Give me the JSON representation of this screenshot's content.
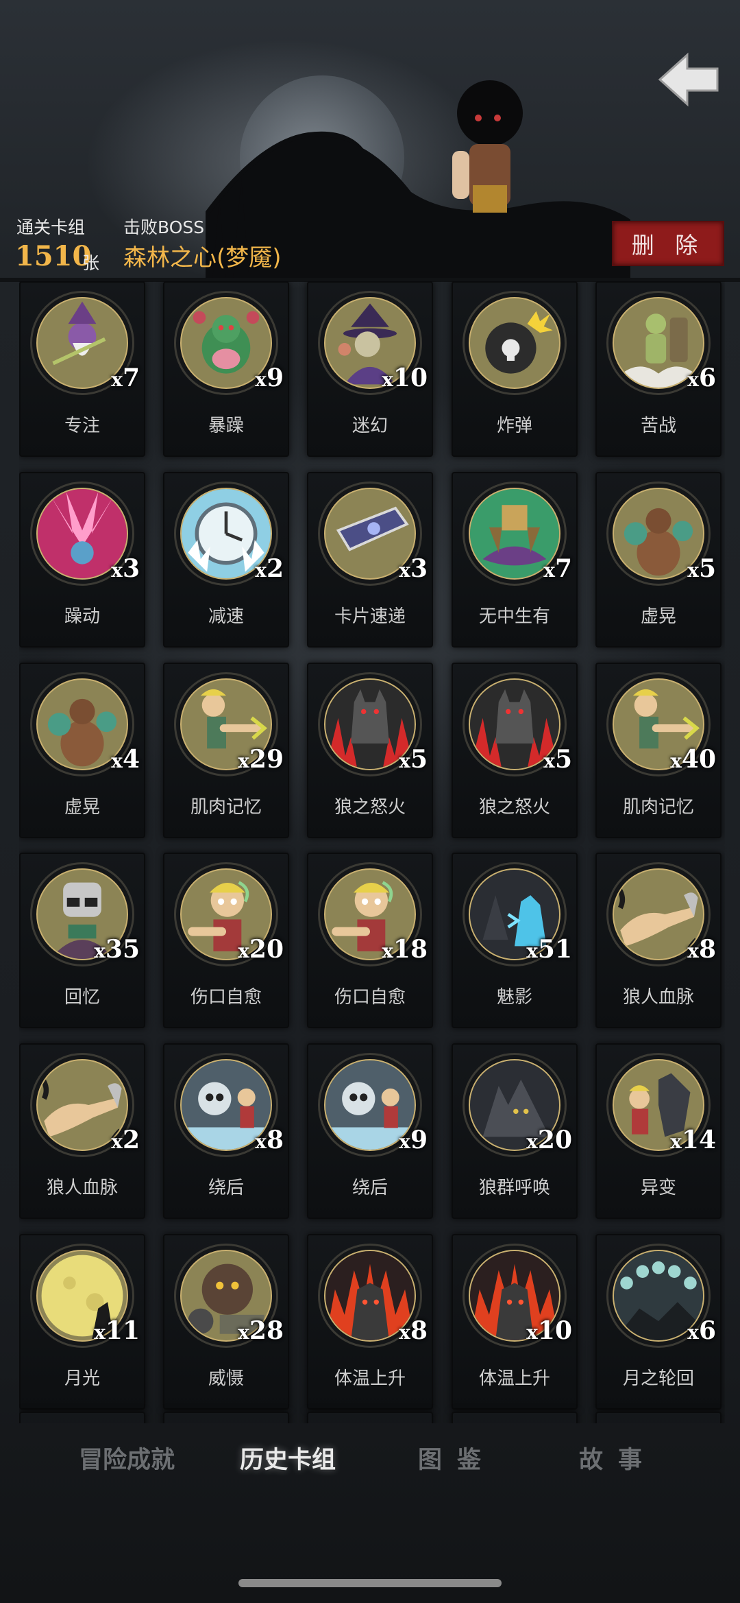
{
  "header": {
    "cards_label": "通关卡组",
    "cards_count": "1510",
    "cards_unit": "张",
    "boss_label": "击败BOSS",
    "boss_name": "森林之心(梦魇)",
    "delete_label": "删 除"
  },
  "colors": {
    "accent": "#f2b64a",
    "delete": "#8e1b1b",
    "background": "#1b1e22"
  },
  "cards": [
    {
      "name": "专注",
      "qty": "7",
      "art": "wizard"
    },
    {
      "name": "暴躁",
      "qty": "9",
      "art": "ogre"
    },
    {
      "name": "迷幻",
      "qty": "10",
      "art": "witch"
    },
    {
      "name": "炸弹",
      "qty": "",
      "art": "bomb"
    },
    {
      "name": "苦战",
      "qty": "6",
      "art": "soldier"
    },
    {
      "name": "躁动",
      "qty": "3",
      "art": "burst"
    },
    {
      "name": "减速",
      "qty": "2",
      "art": "clock"
    },
    {
      "name": "卡片速递",
      "qty": "3",
      "art": "card"
    },
    {
      "name": "无中生有",
      "qty": "7",
      "art": "spawn"
    },
    {
      "name": "虚晃",
      "qty": "5",
      "art": "boxer"
    },
    {
      "name": "虚晃",
      "qty": "4",
      "art": "boxer"
    },
    {
      "name": "肌肉记忆",
      "qty": "29",
      "art": "kid-arm"
    },
    {
      "name": "狼之怒火",
      "qty": "5",
      "art": "wolf-red"
    },
    {
      "name": "狼之怒火",
      "qty": "5",
      "art": "wolf-red"
    },
    {
      "name": "肌肉记忆",
      "qty": "40",
      "art": "kid-arm"
    },
    {
      "name": "回忆",
      "qty": "35",
      "art": "grandpa"
    },
    {
      "name": "伤口自愈",
      "qty": "20",
      "art": "kid-hurt"
    },
    {
      "name": "伤口自愈",
      "qty": "18",
      "art": "kid-hurt"
    },
    {
      "name": "魅影",
      "qty": "51",
      "art": "phantom"
    },
    {
      "name": "狼人血脉",
      "qty": "8",
      "art": "arm"
    },
    {
      "name": "狼人血脉",
      "qty": "2",
      "art": "arm"
    },
    {
      "name": "绕后",
      "qty": "8",
      "art": "skull"
    },
    {
      "name": "绕后",
      "qty": "9",
      "art": "skull"
    },
    {
      "name": "狼群呼唤",
      "qty": "20",
      "art": "wolves"
    },
    {
      "name": "异变",
      "qty": "14",
      "art": "mutation"
    },
    {
      "name": "月光",
      "qty": "11",
      "art": "moon"
    },
    {
      "name": "威慑",
      "qty": "28",
      "art": "bear"
    },
    {
      "name": "体温上升",
      "qty": "8",
      "art": "fire-wolf"
    },
    {
      "name": "体温上升",
      "qty": "10",
      "art": "fire-wolf"
    },
    {
      "name": "月之轮回",
      "qty": "6",
      "art": "phases"
    }
  ],
  "tabs": {
    "adventure": "冒险成就",
    "history": "历史卡组",
    "atlas": "图鉴",
    "story": "故事"
  }
}
